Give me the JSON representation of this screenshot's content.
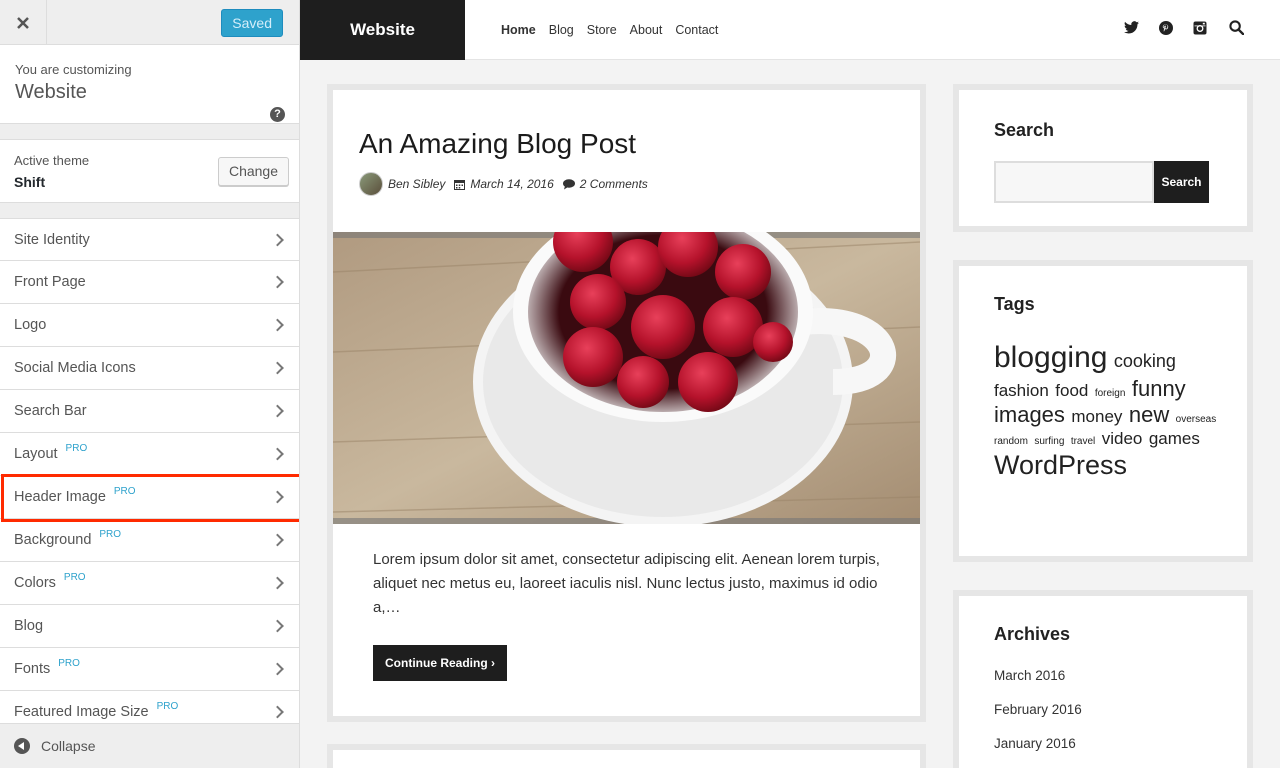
{
  "customizer": {
    "close_icon": "close-icon",
    "saved_label": "Saved",
    "info_label": "You are customizing",
    "info_title": "Website",
    "help_icon": "?",
    "theme_label": "Active theme",
    "theme_name": "Shift",
    "change_label": "Change",
    "sections": [
      {
        "label": "Site Identity",
        "pro": ""
      },
      {
        "label": "Front Page",
        "pro": ""
      },
      {
        "label": "Logo",
        "pro": ""
      },
      {
        "label": "Social Media Icons",
        "pro": ""
      },
      {
        "label": "Search Bar",
        "pro": ""
      },
      {
        "label": "Layout",
        "pro": "PRO"
      },
      {
        "label": "Header Image",
        "pro": "PRO"
      },
      {
        "label": "Background",
        "pro": "PRO"
      },
      {
        "label": "Colors",
        "pro": "PRO"
      },
      {
        "label": "Blog",
        "pro": ""
      },
      {
        "label": "Fonts",
        "pro": "PRO"
      },
      {
        "label": "Featured Image Size",
        "pro": "PRO"
      }
    ],
    "collapse_label": "Collapse",
    "highlight_color": "#ff2a00"
  },
  "site": {
    "title": "Website",
    "nav": [
      "Home",
      "Blog",
      "Store",
      "About",
      "Contact"
    ],
    "active_nav": "Home",
    "social_icons": [
      "twitter-icon",
      "pinterest-icon",
      "instagram-icon",
      "search-icon"
    ]
  },
  "post": {
    "title": "An Amazing Blog Post",
    "author": "Ben Sibley",
    "date": "March 14, 2016",
    "comments": "2 Comments",
    "excerpt": "Lorem ipsum dolor sit amet, consectetur adipiscing elit. Aenean lorem turpis, aliquet nec metus eu, laoreet iaculis nisl. Nunc lectus justo, maximus id odio a,…",
    "continue_label": "Continue Reading ›"
  },
  "widgets": {
    "search": {
      "title": "Search",
      "button": "Search"
    },
    "tags": {
      "title": "Tags",
      "items": [
        {
          "label": "blogging",
          "size": 30
        },
        {
          "label": "cooking",
          "size": 18
        },
        {
          "label": "fashion",
          "size": 17
        },
        {
          "label": "food",
          "size": 17
        },
        {
          "label": "foreign",
          "size": 10
        },
        {
          "label": "funny",
          "size": 22
        },
        {
          "label": "images",
          "size": 22
        },
        {
          "label": "money",
          "size": 17
        },
        {
          "label": "new",
          "size": 22
        },
        {
          "label": "overseas",
          "size": 10
        },
        {
          "label": "random",
          "size": 10
        },
        {
          "label": "surfing",
          "size": 10
        },
        {
          "label": "travel",
          "size": 10
        },
        {
          "label": "video",
          "size": 17
        },
        {
          "label": "games",
          "size": 17
        },
        {
          "label": "WordPress",
          "size": 27
        }
      ]
    },
    "archives": {
      "title": "Archives",
      "items": [
        "March 2016",
        "February 2016",
        "January 2016"
      ]
    }
  }
}
